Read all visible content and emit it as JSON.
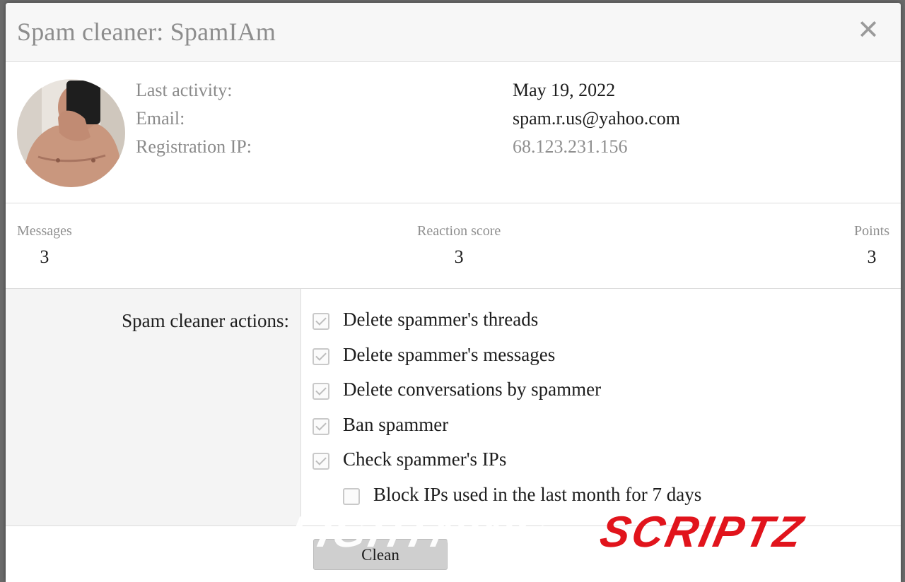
{
  "dialog": {
    "title": "Spam cleaner: SpamIAm",
    "close_glyph": "✕"
  },
  "user": {
    "labels": {
      "last_activity": "Last activity:",
      "email": "Email:",
      "registration_ip": "Registration IP:"
    },
    "values": {
      "last_activity": "May 19, 2022",
      "email": "spam.r.us@yahoo.com",
      "registration_ip": "68.123.231.156"
    }
  },
  "stats": {
    "messages": {
      "label": "Messages",
      "value": "3"
    },
    "reaction_score": {
      "label": "Reaction score",
      "value": "3"
    },
    "points": {
      "label": "Points",
      "value": "3"
    }
  },
  "form": {
    "label": "Spam cleaner actions:",
    "options": [
      {
        "label": "Delete spammer's threads",
        "checked": true
      },
      {
        "label": "Delete spammer's messages",
        "checked": true
      },
      {
        "label": "Delete conversations by spammer",
        "checked": true
      },
      {
        "label": "Ban spammer",
        "checked": true
      },
      {
        "label": "Check spammer's IPs",
        "checked": true
      },
      {
        "label": "Block IPs used in the last month for 7 days",
        "checked": false
      }
    ]
  },
  "footer": {
    "clean_label": "Clean"
  },
  "watermark": {
    "white_text": "LIGHTNING",
    "red_text": "SCRIPTZ"
  },
  "colors": {
    "title": "#8d8d8d",
    "watermark_red": "#e1141c",
    "button_bg": "#cfcfcf"
  }
}
